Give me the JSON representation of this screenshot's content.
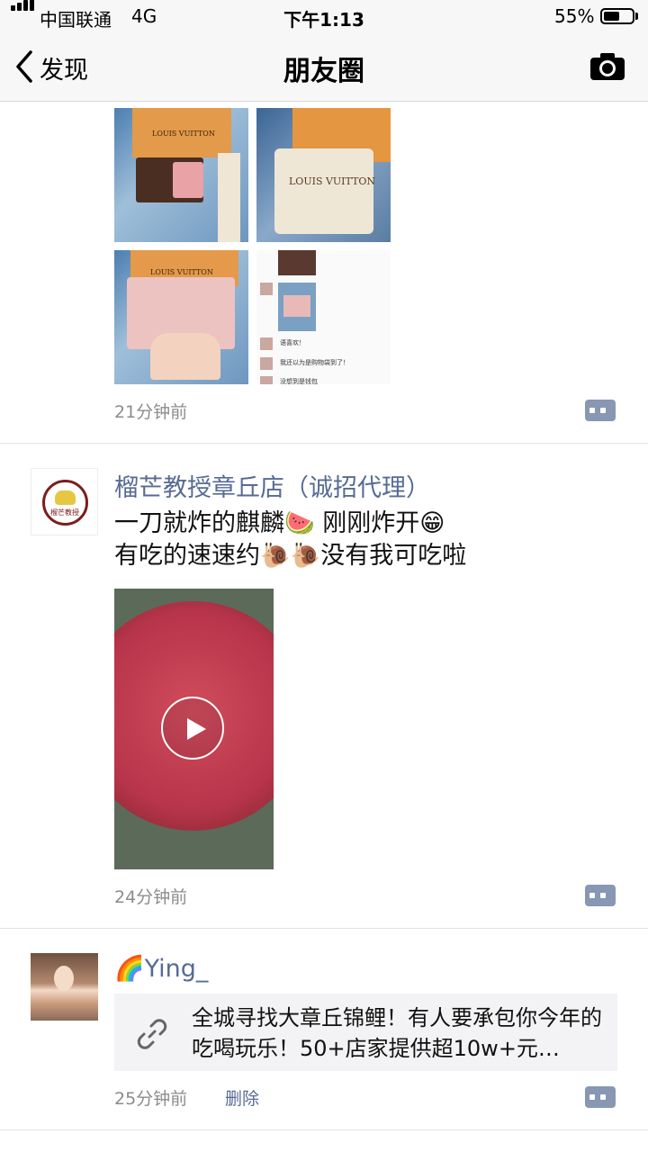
{
  "status_bar": {
    "carrier": "中国联通",
    "network": "4G",
    "time": "下午1:13",
    "battery": "55%",
    "battery_level": 0.55
  },
  "nav": {
    "back_label": "发现",
    "title": "朋友圈"
  },
  "posts": [
    {
      "time": "21分钟前",
      "images": [
        {
          "text": "LOUIS VUITTON"
        },
        {
          "text": "LOUIS VUITTON"
        },
        {
          "text": "LOUIS VUITTON"
        },
        {
          "chat": [
            "语喜欢！",
            "我还以为是购物袋到了！",
            "没想到是钱包"
          ]
        }
      ]
    },
    {
      "name": "榴芒教授章丘店（诚招代理）",
      "avatar_text": "榴芒教授",
      "line1": "一刀就炸的麒麟🍉 刚刚炸开😁",
      "line2": "有吃的速速约🐌🐌没有我可吃啦",
      "time": "24分钟前"
    },
    {
      "name": "🌈Ying_",
      "link_text": "全城寻找大章丘锦鲤！有人要承包你今年的吃喝玩乐！50+店家提供超10w+元…",
      "time": "25分钟前",
      "delete_label": "删除"
    }
  ]
}
